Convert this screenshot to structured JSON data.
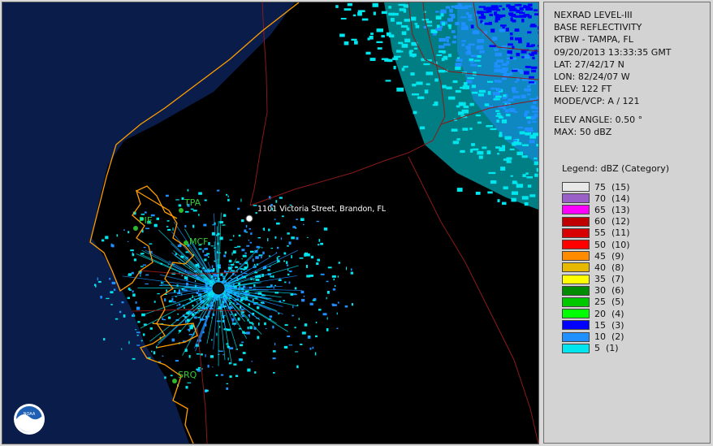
{
  "info": {
    "product": "NEXRAD LEVEL-III",
    "type": "BASE REFLECTIVITY",
    "station": "KTBW - TAMPA, FL",
    "datetime": "09/20/2013 13:33:35 GMT",
    "lat": "LAT: 27/42/17 N",
    "lon": "LON: 82/24/07 W",
    "elev": "ELEV: 122 FT",
    "mode": "MODE/VCP: A / 121",
    "elev_angle": "ELEV ANGLE: 0.50 °",
    "max": "MAX: 50 dBZ"
  },
  "legend": {
    "title": "Legend: dBZ (Category)",
    "items": [
      {
        "label": "75  (15)",
        "color": "#e8e8e8"
      },
      {
        "label": "70  (14)",
        "color": "#9b5fc8"
      },
      {
        "label": "65  (13)",
        "color": "#ff00ff"
      },
      {
        "label": "60  (12)",
        "color": "#c00000"
      },
      {
        "label": "55  (11)",
        "color": "#d80000"
      },
      {
        "label": "50  (10)",
        "color": "#ff0000"
      },
      {
        "label": "45  (9)",
        "color": "#ff8c00"
      },
      {
        "label": "40  (8)",
        "color": "#e6b800"
      },
      {
        "label": "35  (7)",
        "color": "#ffff00"
      },
      {
        "label": "30  (6)",
        "color": "#008c00"
      },
      {
        "label": "25  (5)",
        "color": "#00c800"
      },
      {
        "label": "20  (4)",
        "color": "#00ff00"
      },
      {
        "label": "15  (3)",
        "color": "#0000ff"
      },
      {
        "label": "10  (2)",
        "color": "#1e90ff"
      },
      {
        "label": "5  (1)",
        "color": "#00e5ee"
      }
    ]
  },
  "map": {
    "location_label": "1101 Victoria Street, Brandon, FL",
    "cities": [
      {
        "code": "TPA"
      },
      {
        "code": "PIE"
      },
      {
        "code": "MCF"
      },
      {
        "code": "SRQ"
      }
    ],
    "logo_text": "NOAA"
  }
}
